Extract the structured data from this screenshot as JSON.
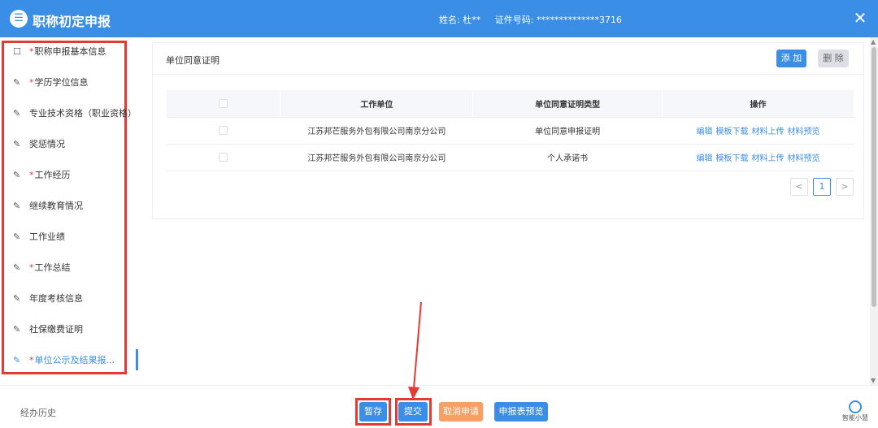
{
  "header": {
    "title": "职称初定申报",
    "name_label": "姓名:",
    "name_value": "杜**",
    "id_label": "证件号码:",
    "id_value": "**************3716",
    "logo_icon": "list-icon",
    "close_icon": "close-icon"
  },
  "sidebar": {
    "items": [
      {
        "label": "职称申报基本信息",
        "required": true,
        "icon": "edit-icon"
      },
      {
        "label": "学历学位信息",
        "required": true,
        "icon": "pencil-icon"
      },
      {
        "label": "专业技术资格（职业资格）",
        "required": false,
        "icon": "pencil-icon"
      },
      {
        "label": "奖惩情况",
        "required": false,
        "icon": "pencil-icon"
      },
      {
        "label": "工作经历",
        "required": true,
        "icon": "pencil-icon"
      },
      {
        "label": "继续教育情况",
        "required": false,
        "icon": "pencil-icon"
      },
      {
        "label": "工作业绩",
        "required": false,
        "icon": "pencil-icon"
      },
      {
        "label": "工作总结",
        "required": true,
        "icon": "pencil-icon"
      },
      {
        "label": "年度考核信息",
        "required": false,
        "icon": "pencil-icon"
      },
      {
        "label": "社保缴费证明",
        "required": false,
        "icon": "pencil-icon"
      },
      {
        "label": "单位公示及结果报...",
        "required": true,
        "icon": "pencil-icon",
        "active": true
      }
    ]
  },
  "section": {
    "title": "单位同意证明",
    "add_label": "添 加",
    "delete_label": "删 除"
  },
  "table": {
    "columns": [
      "工作单位",
      "单位同意证明类型",
      "操作"
    ],
    "rows": [
      {
        "unit": "江苏邦芒服务外包有限公司南京分公司",
        "type": "单位同意申报证明",
        "actions": [
          "编辑",
          "模板下载",
          "材料上传",
          "材料预览"
        ]
      },
      {
        "unit": "江苏邦芒服务外包有限公司南京分公司",
        "type": "个人承诺书",
        "actions": [
          "编辑",
          "模板下载",
          "材料上传",
          "材料预览"
        ]
      }
    ]
  },
  "pager": {
    "prev": "<",
    "current": "1",
    "next": ">"
  },
  "footer": {
    "history": "经办历史",
    "save": "暂存",
    "submit": "提交",
    "cancel": "取消申请",
    "preview": "申报表预览",
    "assistant": "智能小慧"
  },
  "colors": {
    "primary": "#3a8ee6",
    "cancel": "#f79f65",
    "highlight": "#e53935"
  }
}
